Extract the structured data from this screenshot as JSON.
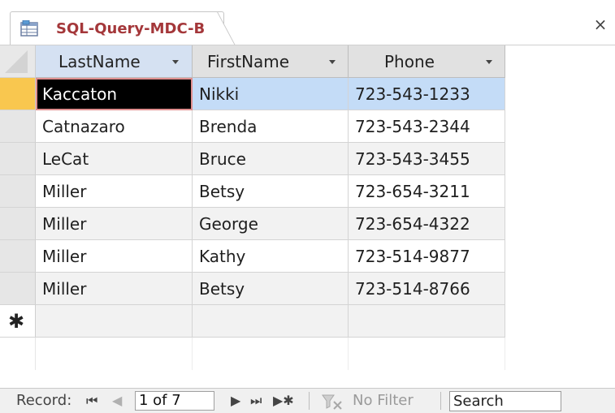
{
  "tab": {
    "title": "SQL-Query-MDC-B",
    "close": "×"
  },
  "columns": [
    {
      "label": "LastName"
    },
    {
      "label": "FirstName"
    },
    {
      "label": "Phone"
    }
  ],
  "rows": [
    {
      "last": "Kaccaton",
      "first": "Nikki",
      "phone": "723-543-1233"
    },
    {
      "last": "Catnazaro",
      "first": "Brenda",
      "phone": "723-543-2344"
    },
    {
      "last": "LeCat",
      "first": "Bruce",
      "phone": "723-543-3455"
    },
    {
      "last": "Miller",
      "first": "Betsy",
      "phone": "723-654-3211"
    },
    {
      "last": "Miller",
      "first": "George",
      "phone": "723-654-4322"
    },
    {
      "last": "Miller",
      "first": "Kathy",
      "phone": "723-514-9877"
    },
    {
      "last": "Miller",
      "first": "Betsy",
      "phone": "723-514-8766"
    }
  ],
  "new_record_marker": "✱",
  "navigation": {
    "label": "Record:",
    "first": "⏮",
    "prev": "◀",
    "position": "1 of 7",
    "next": "▶",
    "last": "⏭",
    "new": "▶✱",
    "filter_label": "No Filter",
    "search_placeholder": "Search"
  },
  "colors": {
    "tab_title": "#a4373a",
    "selected_row": "#c4dcf7",
    "active_cell": "#000000",
    "row_selector_current": "#f9c74f"
  }
}
